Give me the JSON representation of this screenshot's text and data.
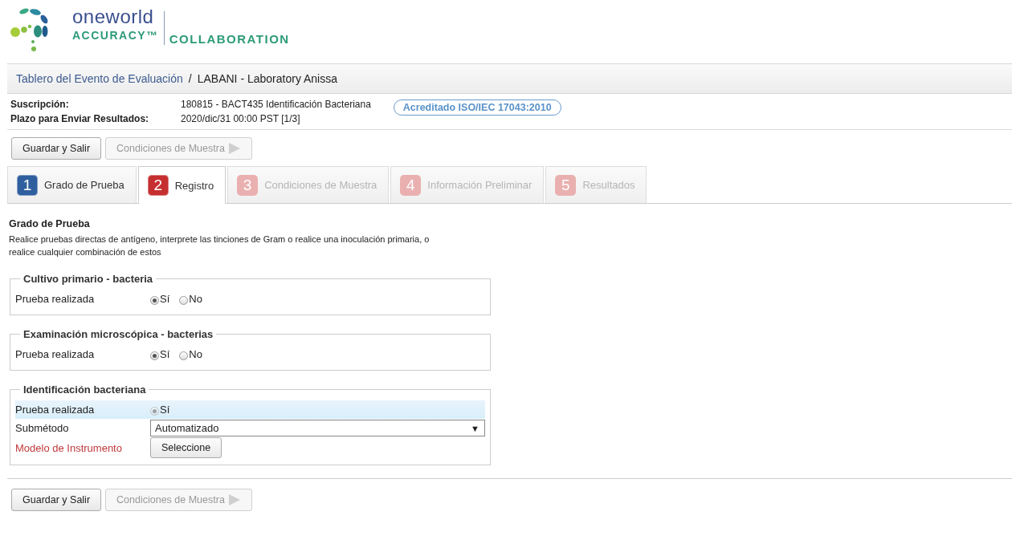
{
  "logo": {
    "name": "oneworld",
    "tagline": "ACCURACY™",
    "partner": "COLLABORATION"
  },
  "breadcrumb": [
    {
      "text": "Tablero del Evento de Evaluación",
      "kind": "link"
    },
    {
      "text": "/",
      "kind": "separator"
    },
    {
      "text": "LABANI - Laboratory Anissa",
      "kind": "current"
    }
  ],
  "info": [
    {
      "label": "Suscripción:",
      "value": "180815 - BACT435 Identificación Bacteriana"
    },
    {
      "label": "Plazo para Enviar Resultados:",
      "value": "2020/dic/31 00:00 PST [1/3]"
    }
  ],
  "badge": "Acreditado ISO/IEC 17043:2010",
  "top_buttons": [
    {
      "label": "Guardar y Salir",
      "disabled": false,
      "arrow": false
    },
    {
      "label": "Condiciones de Muestra",
      "disabled": true,
      "arrow": true
    }
  ],
  "tabs": [
    {
      "number": "1",
      "label": "Grado de Prueba",
      "selected": false,
      "disabled": false,
      "color": "#2f5f9e"
    },
    {
      "number": "2",
      "label": "Registro",
      "selected": true,
      "disabled": false,
      "color": "#c62f2f"
    },
    {
      "number": "3",
      "label": "Condiciones de Muestra",
      "selected": false,
      "disabled": true,
      "color": "#eab0b0"
    },
    {
      "number": "4",
      "label": "Información Preliminar",
      "selected": false,
      "disabled": true,
      "color": "#eab0b0"
    },
    {
      "number": "5",
      "label": "Resultados",
      "selected": false,
      "disabled": true,
      "color": "#eab0b0"
    }
  ],
  "heading": "Grado de Prueba",
  "description": "Realice pruebas directas de antígeno, interprete las tinciones de Gram o realice una inoculación primaria, o realice cualquier combinación de estos",
  "sections": [
    {
      "title": "Cultivo primario - bacteria",
      "rows": [
        {
          "kind": "radio",
          "label": "Prueba realizada",
          "required": false,
          "highlighted": false,
          "options": [
            {
              "label": "Sí",
              "selected": true,
              "disabled": false
            },
            {
              "label": "No",
              "selected": false,
              "disabled": false
            }
          ]
        }
      ]
    },
    {
      "title": "Examinación microscópica - bacterias",
      "rows": [
        {
          "kind": "radio",
          "label": "Prueba realizada",
          "required": false,
          "highlighted": false,
          "options": [
            {
              "label": "Sí",
              "selected": true,
              "disabled": false
            },
            {
              "label": "No",
              "selected": false,
              "disabled": false
            }
          ]
        }
      ]
    },
    {
      "title": "Identificación bacteriana",
      "rows": [
        {
          "kind": "radio",
          "label": "Prueba realizada",
          "required": false,
          "highlighted": true,
          "options": [
            {
              "label": "Sí",
              "selected": true,
              "disabled": true
            }
          ]
        },
        {
          "kind": "select",
          "label": "Submétodo",
          "required": false,
          "highlighted": false,
          "value": "Automatizado",
          "caret": "▼"
        },
        {
          "kind": "button",
          "label": "Modelo de Instrumento",
          "required": true,
          "highlighted": false,
          "button": "Seleccione"
        }
      ]
    }
  ],
  "bottom_buttons": [
    {
      "label": "Guardar y Salir",
      "disabled": false,
      "arrow": false
    },
    {
      "label": "Condiciones de Muestra",
      "disabled": true,
      "arrow": true
    }
  ]
}
